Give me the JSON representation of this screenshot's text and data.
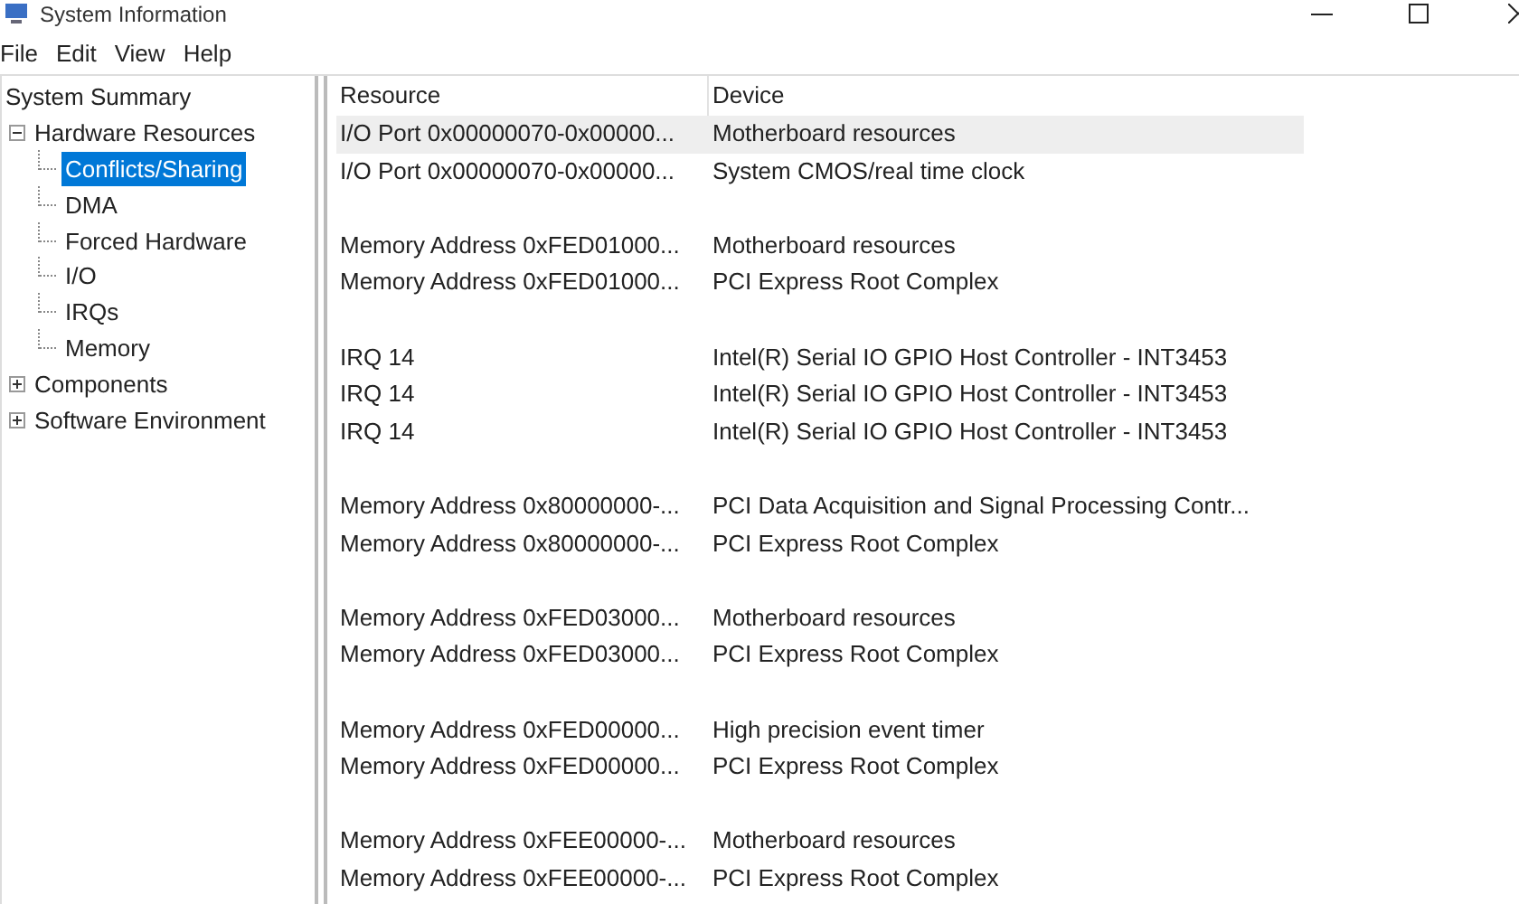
{
  "window": {
    "title": "System Information"
  },
  "menu": [
    "File",
    "Edit",
    "View",
    "Help"
  ],
  "tree": [
    {
      "label": "System Summary",
      "selected": false,
      "children": [
        {
          "label": "Hardware Resources",
          "selected": false,
          "expanded": true,
          "children": [
            {
              "label": "Conflicts/Sharing",
              "selected": true
            },
            {
              "label": "DMA",
              "selected": false
            },
            {
              "label": "Forced Hardware",
              "selected": false
            },
            {
              "label": "I/O",
              "selected": false
            },
            {
              "label": "IRQs",
              "selected": false
            },
            {
              "label": "Memory",
              "selected": false
            }
          ]
        },
        {
          "label": "Components",
          "selected": false,
          "expanded": false
        },
        {
          "label": "Software Environment",
          "selected": false,
          "expanded": false
        }
      ]
    }
  ],
  "table": {
    "columns": [
      "Resource",
      "Device"
    ],
    "groups": [
      {
        "rows": [
          {
            "resource": "I/O Port 0x00000070-0x00000...",
            "device": "Motherboard resources",
            "selected": true
          },
          {
            "resource": "I/O Port 0x00000070-0x00000...",
            "device": "System CMOS/real time clock",
            "selected": false
          }
        ]
      },
      {
        "rows": [
          {
            "resource": "Memory Address 0xFED01000...",
            "device": "Motherboard resources",
            "selected": false
          },
          {
            "resource": "Memory Address 0xFED01000...",
            "device": "PCI Express Root Complex",
            "selected": false
          }
        ]
      },
      {
        "rows": [
          {
            "resource": "IRQ 14",
            "device": "Intel(R) Serial IO GPIO Host Controller - INT3453",
            "selected": false
          },
          {
            "resource": "IRQ 14",
            "device": "Intel(R) Serial IO GPIO Host Controller - INT3453",
            "selected": false
          },
          {
            "resource": "IRQ 14",
            "device": "Intel(R) Serial IO GPIO Host Controller - INT3453",
            "selected": false
          }
        ]
      },
      {
        "rows": [
          {
            "resource": "Memory Address 0x80000000-...",
            "device": "PCI Data Acquisition and Signal Processing Contr...",
            "selected": false
          },
          {
            "resource": "Memory Address 0x80000000-...",
            "device": "PCI Express Root Complex",
            "selected": false
          }
        ]
      },
      {
        "rows": [
          {
            "resource": "Memory Address 0xFED03000...",
            "device": "Motherboard resources",
            "selected": false
          },
          {
            "resource": "Memory Address 0xFED03000...",
            "device": "PCI Express Root Complex",
            "selected": false
          }
        ]
      },
      {
        "rows": [
          {
            "resource": "Memory Address 0xFED00000...",
            "device": "High precision event timer",
            "selected": false
          },
          {
            "resource": "Memory Address 0xFED00000...",
            "device": "PCI Express Root Complex",
            "selected": false
          }
        ]
      },
      {
        "rows": [
          {
            "resource": "Memory Address 0xFEE00000-...",
            "device": "Motherboard resources",
            "selected": false
          },
          {
            "resource": "Memory Address 0xFEE00000-...",
            "device": "PCI Express Root Complex",
            "selected": false
          }
        ]
      }
    ]
  }
}
